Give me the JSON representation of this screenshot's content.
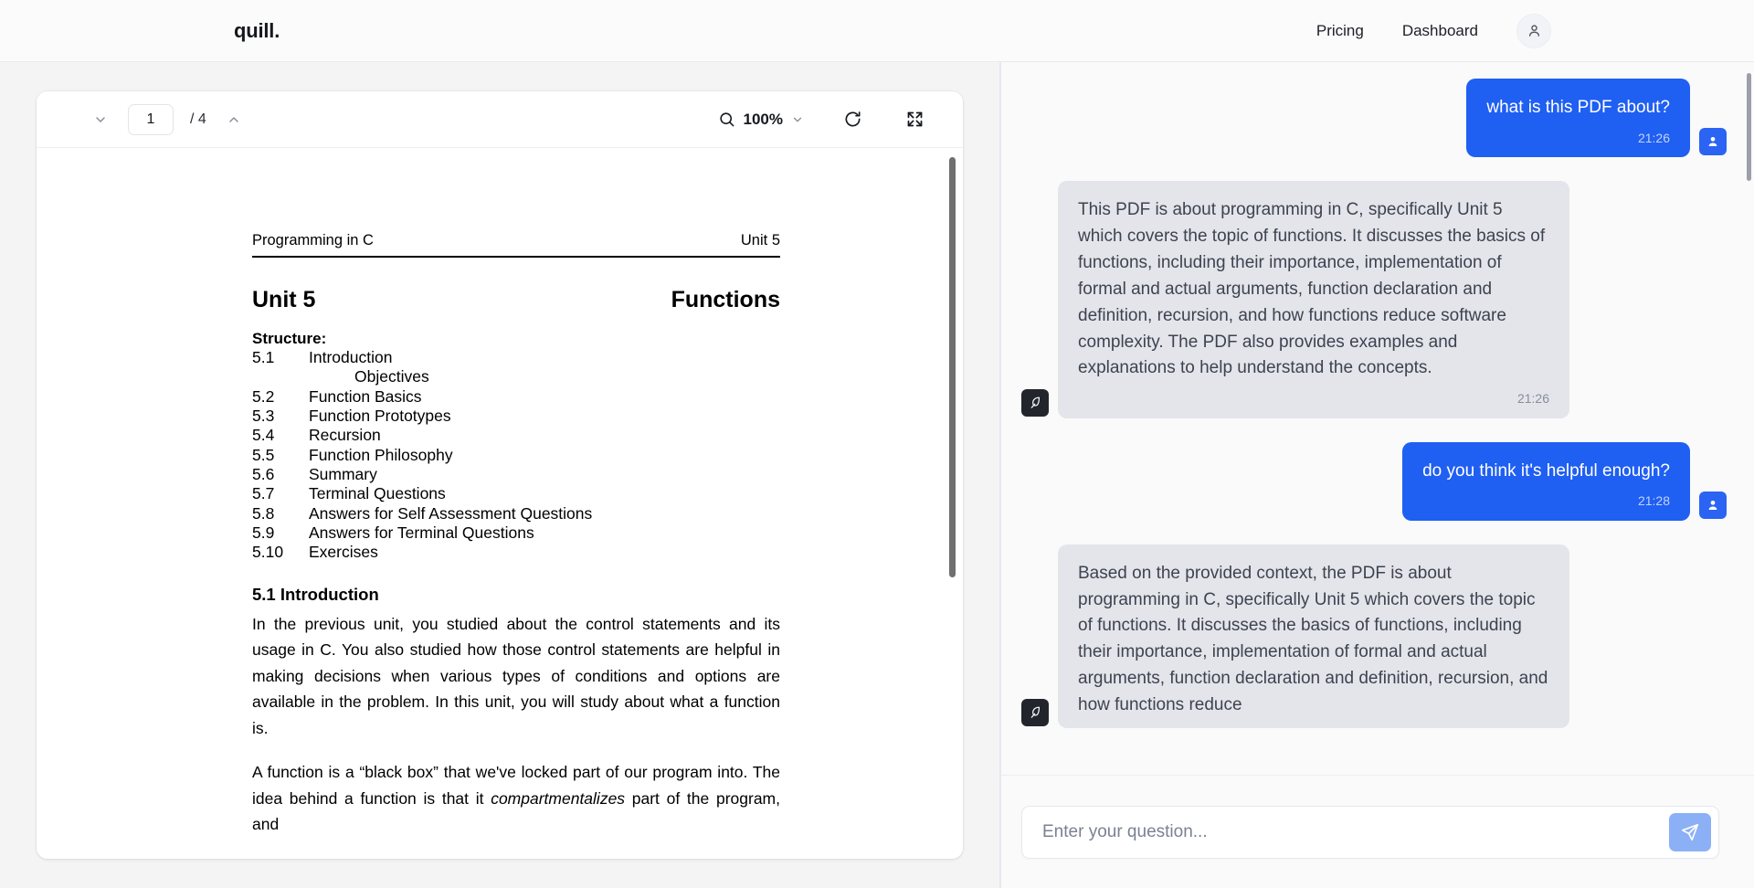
{
  "topbar": {
    "brand": "quill.",
    "links": [
      {
        "label": "Pricing"
      },
      {
        "label": "Dashboard"
      }
    ],
    "avatar_icon": "user-icon"
  },
  "pdf_viewer": {
    "toolbar": {
      "prev_icon": "chevron-down-icon",
      "next_icon": "chevron-up-icon",
      "page_value": "1",
      "page_total": "/ 4",
      "zoom_icon": "search-icon",
      "zoom_value": "100%",
      "zoom_chevron_icon": "chevron-down-icon",
      "refresh_icon": "refresh-icon",
      "fullscreen_icon": "expand-icon"
    },
    "document": {
      "header_left": "Programming in C",
      "header_right": "Unit 5",
      "title_left": "Unit 5",
      "title_right": "Functions",
      "structure_label": "Structure:",
      "structure": [
        {
          "num": "5.1",
          "text": "Introduction"
        },
        {
          "num": "",
          "text": "Objectives",
          "indent": true
        },
        {
          "num": "5.2",
          "text": "Function Basics"
        },
        {
          "num": "5.3",
          "text": "Function Prototypes"
        },
        {
          "num": "5.4",
          "text": "Recursion"
        },
        {
          "num": "5.5",
          "text": "Function Philosophy"
        },
        {
          "num": "5.6",
          "text": "Summary"
        },
        {
          "num": "5.7",
          "text": "Terminal Questions"
        },
        {
          "num": "5.8",
          "text": "Answers for Self Assessment Questions"
        },
        {
          "num": "5.9",
          "text": "Answers for Terminal Questions"
        },
        {
          "num": "5.10",
          "text": "Exercises"
        }
      ],
      "section_heading": "5.1 Introduction",
      "paragraph_1": "In the previous unit, you studied about the control statements and its usage in C. You also studied how those control statements are helpful in making decisions when various types of conditions and options are available in the problem. In this unit, you will study about what a function is.",
      "paragraph_2_a": "A function is a “black box” that we've locked part of our program into. The idea behind a function is that it ",
      "paragraph_2_em": "compartmentalizes",
      "paragraph_2_b": " part of the program, and"
    }
  },
  "chat": {
    "messages": [
      {
        "role": "user",
        "text": "what is this PDF about?",
        "time": "21:26",
        "avatar_icon": "user-icon"
      },
      {
        "role": "bot",
        "text": "This PDF is about programming in C, specifically Unit 5 which covers the topic of functions. It discusses the basics of functions, including their importance, implementation of formal and actual arguments, function declaration and definition, recursion, and how functions reduce software complexity. The PDF also provides examples and explanations to help understand the concepts.",
        "time": "21:26",
        "avatar_icon": "quill-icon"
      },
      {
        "role": "user",
        "text": "do you think it's helpful enough?",
        "time": "21:28",
        "avatar_icon": "user-icon"
      },
      {
        "role": "bot",
        "text": "Based on the provided context, the PDF is about programming in C, specifically Unit 5 which covers the topic of functions. It discusses the basics of functions, including their importance, implementation of formal and actual arguments, function declaration and definition, recursion, and how functions reduce",
        "time": "",
        "avatar_icon": "quill-icon"
      }
    ],
    "composer": {
      "placeholder": "Enter your question...",
      "value": "",
      "send_icon": "send-icon"
    }
  },
  "colors": {
    "user_bubble": "#1f5ff2",
    "bot_bubble": "#e3e5ea",
    "send_button": "#8cb0f5",
    "bot_avatar": "#22252c"
  }
}
